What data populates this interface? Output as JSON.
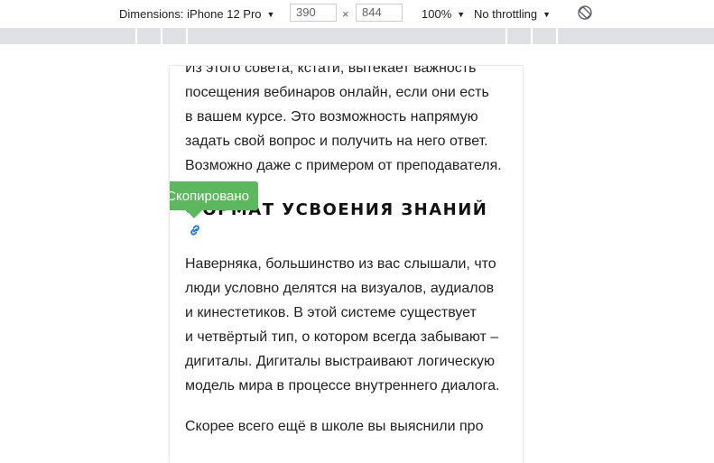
{
  "devtools": {
    "dimensions_label": "Dimensions: iPhone 12 Pro",
    "width_value": "390",
    "height_value": "844",
    "times_symbol": "×",
    "zoom_label": "100%",
    "throttling_label": "No throttling"
  },
  "article": {
    "para1": [
      "Из этого совета, кстати, вытекает важность",
      "посещения вебинаров онлайн, если они есть",
      "в вашем курсе. Это возможность напрямую",
      "задать свой вопрос и получить на него ответ.",
      "Возможно даже с примером от преподавателя."
    ],
    "heading": "ФОРМАТ УСВОЕНИЯ ЗНАНИЙ",
    "toast": "Скопировано",
    "para2": [
      "Наверняка, большинство из вас слышали, что",
      "люди условно делятся на визуалов, аудиалов",
      "и кинестетиков. В этой системе существует",
      "и четвёртый тип, о котором всегда забывают –",
      "дигиталы. Дигиталы выстраивают логическую",
      "модель мира в процессе внутреннего диалога."
    ],
    "para3": [
      "Скорее всего ещё в школе вы выяснили про"
    ]
  },
  "colors": {
    "toast_bg": "#5cb85c",
    "link_icon": "#1a73e8"
  },
  "icons": {
    "rotate": "rotate-icon",
    "link": "link-icon"
  }
}
